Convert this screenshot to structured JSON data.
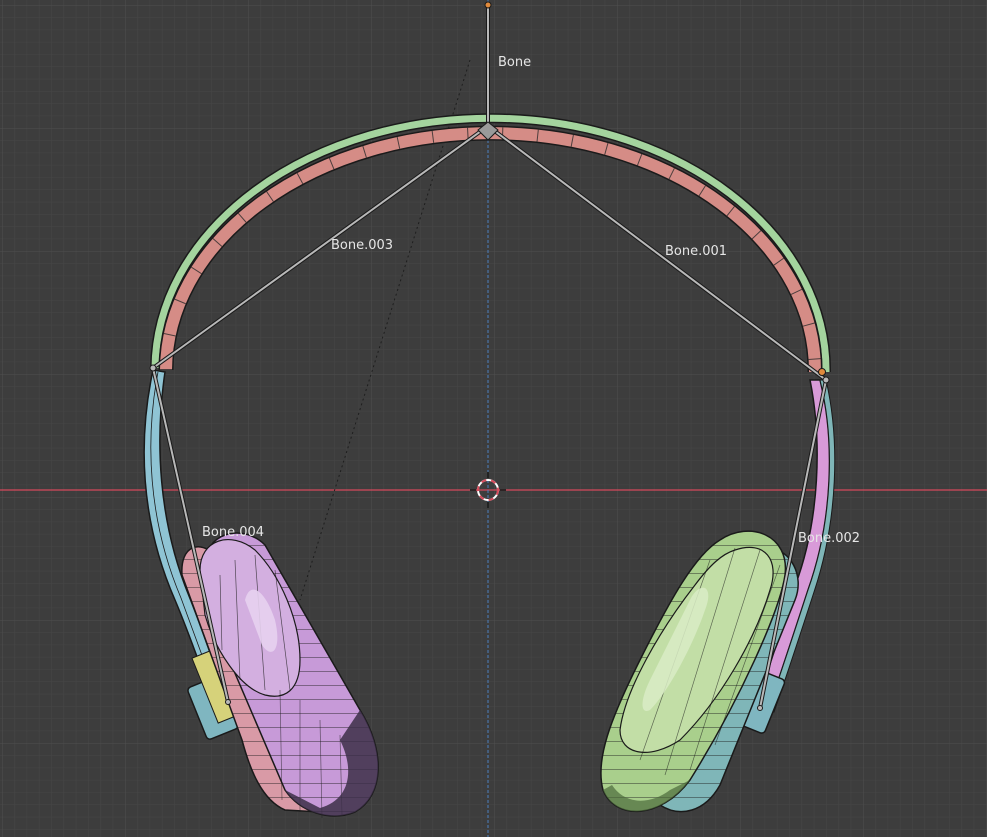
{
  "viewport": {
    "background": "#3d3d3d",
    "grid_minor_color": "#454545",
    "grid_major_color": "#4c4c4c",
    "x_axis_color": "#d64a5b",
    "z_axis_color": "#4a7fc0",
    "cursor_icon": "3d-cursor-icon"
  },
  "bones": [
    {
      "name": "Bone"
    },
    {
      "name": "Bone.001"
    },
    {
      "name": "Bone.002"
    },
    {
      "name": "Bone.003"
    },
    {
      "name": "Bone.004"
    }
  ],
  "colors": {
    "headband": "#d58c86",
    "headband_outline": "#a4d49e",
    "left_earcup": "#c79ad8",
    "left_cushion": "#d99aa6",
    "right_earcup": "#a9cf8c",
    "right_cushion": "#7fb6b8",
    "left_arm": "#8fc4d4",
    "right_arm": "#d89ad8",
    "bone": "#b8b8b8",
    "wire": "#1a1a1a"
  }
}
